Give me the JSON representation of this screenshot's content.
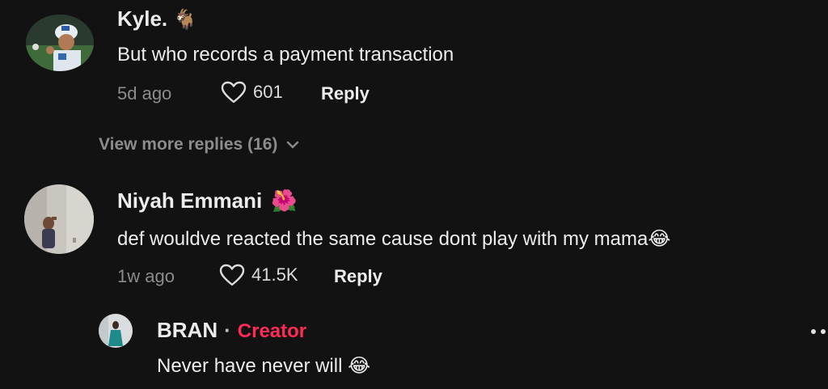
{
  "comments": [
    {
      "username": "Kyle.",
      "emoji": "🐐",
      "text": "But who records a payment transaction",
      "time": "5d ago",
      "likes": "601",
      "reply_label": "Reply"
    },
    {
      "username": "Niyah Emmani",
      "emoji": "🌺",
      "text": "def wouldve reacted the same cause dont play with my mama😂",
      "time": "1w ago",
      "likes": "41.5K",
      "reply_label": "Reply"
    }
  ],
  "view_more": {
    "label": "View more replies (16)"
  },
  "reply": {
    "username": "BRAN",
    "separator": "·",
    "badge": "Creator",
    "text": "Never have never will 😂"
  },
  "colors": {
    "background": "#121212",
    "creator_badge": "#fe2c55",
    "muted": "#8c8c8c"
  },
  "icons": [
    "heart-icon",
    "chevron-down-icon",
    "more-options-icon"
  ]
}
